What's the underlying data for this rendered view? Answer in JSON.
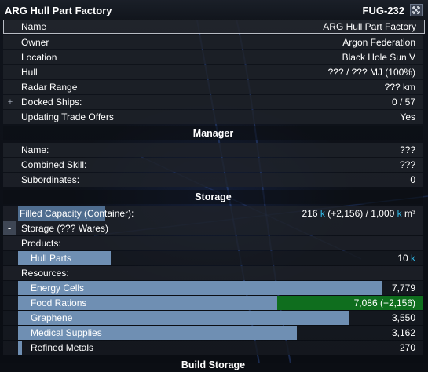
{
  "window": {
    "title": "ARG Hull Part Factory",
    "code": "FUG-232",
    "expand_icon": "expand-icon"
  },
  "info": {
    "name_label": "Name",
    "name_value": "ARG Hull Part Factory",
    "owner_label": "Owner",
    "owner_value": "Argon Federation",
    "location_label": "Location",
    "location_value": "Black Hole Sun V",
    "hull_label": "Hull",
    "hull_value": "??? / ??? MJ (100%)",
    "radar_label": "Radar Range",
    "radar_value": "??? km",
    "docked_label": "Docked Ships:",
    "docked_value": "0 / 57",
    "trade_label": "Updating Trade Offers",
    "trade_value": "Yes"
  },
  "manager": {
    "heading": "Manager",
    "name_label": "Name:",
    "name_value": "???",
    "skill_label": "Combined Skill:",
    "skill_value": "???",
    "subs_label": "Subordinates:",
    "subs_value": "0"
  },
  "storage": {
    "heading": "Storage",
    "capacity_label": "Filled Capacity (Container):",
    "capacity_used": "216",
    "capacity_change": "(+2,156)",
    "capacity_total": "1,000",
    "capacity_unit_k": "k",
    "capacity_unit": "m³",
    "capacity_fraction": 0.216,
    "storage_label": "Storage (??? Wares)",
    "products_label": "Products:",
    "resources_label": "Resources:",
    "products": [
      {
        "name": "Hull Parts",
        "value": "10",
        "unit": "k",
        "fill": 0.23
      }
    ],
    "resources": [
      {
        "name": "Energy Cells",
        "value": "7,779",
        "fill": 0.9
      },
      {
        "name": "Food Rations",
        "value": "7,086 (+2,156)",
        "fill": 0.64,
        "growth_fill": 0.36
      },
      {
        "name": "Graphene",
        "value": "3,550",
        "fill": 0.82
      },
      {
        "name": "Medical Supplies",
        "value": "3,162",
        "fill": 0.69
      },
      {
        "name": "Refined Metals",
        "value": "270",
        "fill": 0.01
      }
    ]
  },
  "footer": {
    "heading": "Build Storage"
  },
  "colors": {
    "bar": "#6f8fb3",
    "growth": "#0f6e1e",
    "accent_k": "#31b8e6"
  }
}
